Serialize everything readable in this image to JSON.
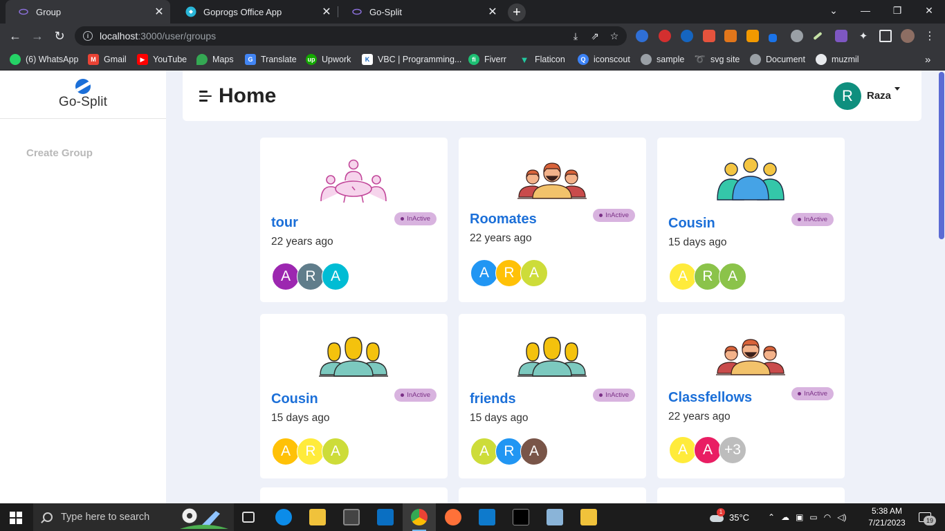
{
  "browser": {
    "tabs": [
      {
        "title": "Group",
        "active": true
      },
      {
        "title": "Goprogs Office App",
        "active": false
      },
      {
        "title": "Go-Split",
        "active": false
      }
    ],
    "new_tab_label": "+",
    "address": {
      "host": "localhost",
      "path": ":3000/user/groups"
    },
    "bookmarks": [
      {
        "label": "(6) WhatsApp",
        "color": "#25d366"
      },
      {
        "label": "Gmail",
        "color": "#ea4335"
      },
      {
        "label": "YouTube",
        "color": "#ff0000"
      },
      {
        "label": "Maps",
        "color": "#34a853"
      },
      {
        "label": "Translate",
        "color": "#4285f4"
      },
      {
        "label": "Upwork",
        "color": "#14a800"
      },
      {
        "label": "VBC | Programming...",
        "color": "#ffffff"
      },
      {
        "label": "Fiverr",
        "color": "#1dbf73"
      },
      {
        "label": "Flaticon",
        "color": "#22c9a0"
      },
      {
        "label": "iconscout",
        "color": "#3b82f6"
      },
      {
        "label": "sample",
        "color": "#9aa0a6"
      },
      {
        "label": "svg site",
        "color": "#1a73e8"
      },
      {
        "label": "Document",
        "color": "#9aa0a6"
      },
      {
        "label": "muzmil",
        "color": "#e8eaed"
      }
    ],
    "more_bookmarks": "»"
  },
  "app": {
    "logo_text": "Go-Split",
    "sidebar_links": [
      "Create Group"
    ],
    "page_title": "Home",
    "user": {
      "initial": "R",
      "name": "Raza",
      "avatar_color": "#0f8f7e"
    },
    "status_label": "InActive",
    "groups": [
      {
        "name": "tour",
        "time": "22 years ago",
        "illustration": "meeting-table-icon",
        "members": [
          {
            "i": "A",
            "c": "#9c27b0"
          },
          {
            "i": "R",
            "c": "#607d8b"
          },
          {
            "i": "A",
            "c": "#00bcd4"
          }
        ]
      },
      {
        "name": "Roomates",
        "time": "22 years ago",
        "illustration": "bearded-men-icon",
        "members": [
          {
            "i": "A",
            "c": "#2196f3"
          },
          {
            "i": "R",
            "c": "#ffc107"
          },
          {
            "i": "A",
            "c": "#cddc39"
          }
        ]
      },
      {
        "name": "Cousin",
        "time": "15 days ago",
        "illustration": "three-people-icon",
        "members": [
          {
            "i": "A",
            "c": "#ffeb3b"
          },
          {
            "i": "R",
            "c": "#8bc34a"
          },
          {
            "i": "A",
            "c": "#8bc34a"
          }
        ]
      },
      {
        "name": "Cousin",
        "time": "15 days ago",
        "illustration": "yellow-team-icon",
        "members": [
          {
            "i": "A",
            "c": "#ffc107"
          },
          {
            "i": "R",
            "c": "#ffeb3b"
          },
          {
            "i": "A",
            "c": "#cddc39"
          }
        ]
      },
      {
        "name": "friends",
        "time": "15 days ago",
        "illustration": "yellow-team-icon",
        "members": [
          {
            "i": "A",
            "c": "#cddc39"
          },
          {
            "i": "R",
            "c": "#2196f3"
          },
          {
            "i": "A",
            "c": "#795548"
          }
        ]
      },
      {
        "name": "Classfellows",
        "time": "22 years ago",
        "illustration": "bearded-men-icon",
        "members": [
          {
            "i": "A",
            "c": "#ffeb3b"
          },
          {
            "i": "A",
            "c": "#e91e63"
          },
          {
            "i": "+3",
            "c": "#bdbdbd"
          }
        ]
      }
    ]
  },
  "taskbar": {
    "search_placeholder": "Type here to search",
    "weather": "35°C",
    "weather_badge": "1",
    "time": "5:38 AM",
    "date": "7/21/2023",
    "notifications": "19"
  }
}
